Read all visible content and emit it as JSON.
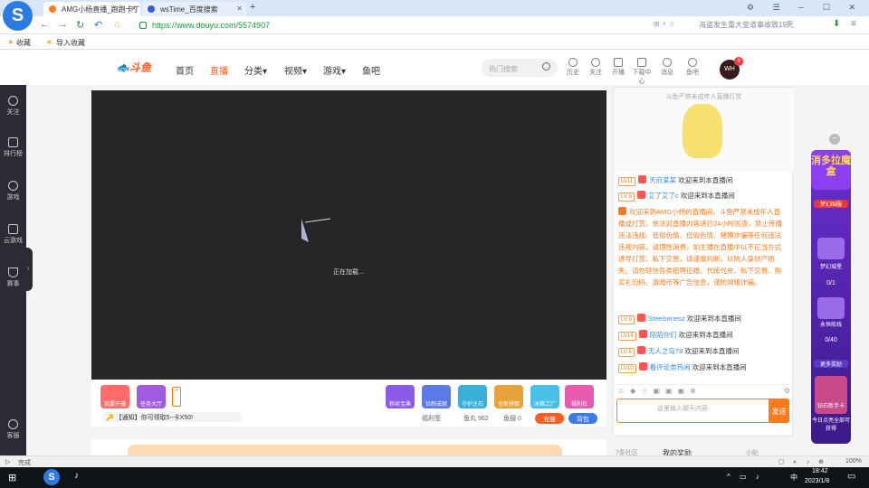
{
  "browser": {
    "tabs": [
      {
        "title": "AMG小杨直播_跑跑卡丁"
      },
      {
        "title": "wsTime_百度搜索"
      }
    ],
    "url": "https://www.douyu.com/5574907",
    "address_hint": "海盗发生重大变道事故致19死",
    "bookmarks": [
      "收藏",
      "导入收藏"
    ]
  },
  "site": {
    "logo_text": "斗鱼",
    "nav": [
      "首页",
      "直播",
      "分类",
      "视频",
      "游戏",
      "鱼吧"
    ],
    "search_placeholder": "热门搜索",
    "header_icons": [
      "历史",
      "关注",
      "开播",
      "下载中心",
      "消息",
      "鱼吧"
    ],
    "avatar_text": "WH",
    "avatar_badge": "8"
  },
  "sidebar": [
    "关注",
    "排行榜",
    "游戏",
    "云游戏",
    "赛事",
    "客服"
  ],
  "player": {
    "loading_text": "正在加载...",
    "actions": [
      "我要开播",
      "任务大厅",
      "粉丝宝典",
      "钻粉成就",
      "守护之石",
      "全新拼图",
      "冰箱工厂",
      "福利社"
    ],
    "notice": "【通知】你可领取5~卡X50!",
    "info": [
      "福利签",
      "鱼丸 962",
      "鱼翅 0"
    ],
    "recharge_label": "充值",
    "backpack_label": "背包"
  },
  "chat": {
    "banner_text": "斗鱼严禁未成年人直播打赏",
    "messages": [
      {
        "lv": "LV11",
        "user": "天府某某",
        "text": "欢迎来到本直播间"
      },
      {
        "lv": "LV 9",
        "user": "艾了艾了c",
        "text": "欢迎来到本直播间"
      }
    ],
    "system": "欢迎来到AMG小杨的直播间。斗鱼严禁未成年人直播或打赏，依法对直播内容进行24小时巡查，禁止传播违法违规、低俗色情、低俗色情、赌博诈骗等任何违法违规内容。请理性消费，如主播在直播中以不正当方式诱导打赏、私下交易，请谨慎判断，以防人身财产损失。请勿轻信各类招聘征婚、代练代充、私下交易、购买礼包码、游戏币等广告信息，谨防网络诈骗。",
    "messages2": [
      {
        "lv": "LV 9",
        "user": "Steelseriesz",
        "text": "欢迎来到本直播间"
      },
      {
        "lv": "LV14",
        "user": "陌陌你们",
        "text": "欢迎来到本直播间"
      },
      {
        "lv": "LV 6",
        "user": "无人之岛78",
        "text": "欢迎来到本直播间"
      },
      {
        "lv": "LV10",
        "user": "看评论类热闹",
        "text": "欢迎来到本直播间"
      }
    ],
    "input_placeholder": "这里输入聊天内容",
    "send_label": "发送",
    "bottom_tabs": [
      "7条社区",
      "我的奖励",
      "小贴"
    ]
  },
  "promo": {
    "title": "消多拉魔盒",
    "subtitle": "梦幻国服",
    "items": [
      {
        "label": "梦幻城堡",
        "count": "0/1"
      },
      {
        "label": "永恒航线",
        "count": "0/40"
      }
    ],
    "more": "更多奖励",
    "card": "钻石新手卡",
    "footer": "今日点亮全部可获得"
  },
  "statusbar": {
    "left": "完成",
    "zoom": "100%"
  },
  "taskbar": {
    "time": "18:42",
    "date": "2023/1/8",
    "ime": "中"
  }
}
